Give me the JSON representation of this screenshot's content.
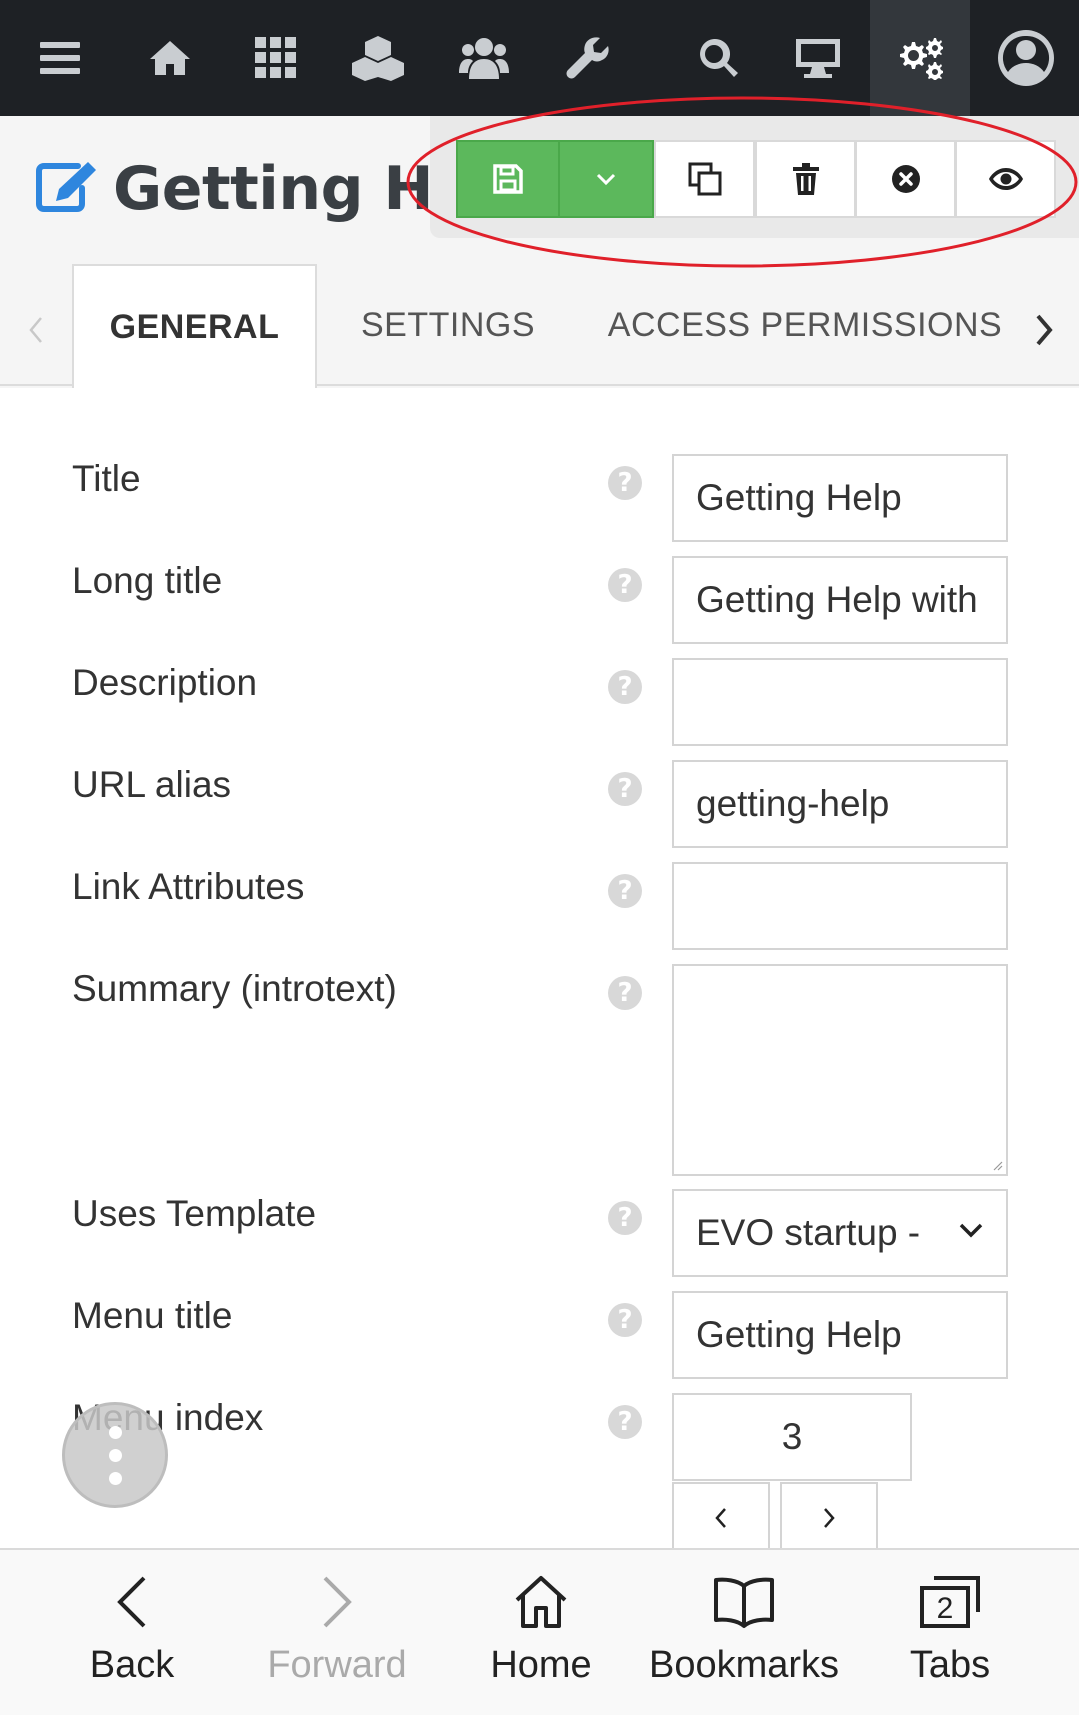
{
  "page": {
    "title": "Getting Help"
  },
  "tabs": [
    {
      "label": "GENERAL",
      "active": true
    },
    {
      "label": "SETTINGS",
      "active": false
    },
    {
      "label": "ACCESS PERMISSIONS",
      "active": false
    }
  ],
  "form": {
    "title": {
      "label": "Title",
      "value": "Getting Help"
    },
    "longtitle": {
      "label": "Long title",
      "value": "Getting Help with"
    },
    "description": {
      "label": "Description",
      "value": ""
    },
    "alias": {
      "label": "URL alias",
      "value": "getting-help"
    },
    "link_attributes": {
      "label": "Link Attributes",
      "value": ""
    },
    "summary": {
      "label": "Summary (introtext)",
      "value": ""
    },
    "template": {
      "label": "Uses Template",
      "value": "EVO startup -"
    },
    "menu_title": {
      "label": "Menu title",
      "value": "Getting Help"
    },
    "menu_index": {
      "label": "Menu index",
      "value": "3"
    }
  },
  "help_glyph": "?",
  "bottom_bar": {
    "back": "Back",
    "forward": "Forward",
    "home": "Home",
    "bookmarks": "Bookmarks",
    "tabs": "Tabs",
    "tab_count": "2"
  },
  "colors": {
    "nav_bg": "#1e2125",
    "save_green": "#5cb85c",
    "title_icon_blue": "#2e86de",
    "highlight_red": "#e0202a"
  }
}
